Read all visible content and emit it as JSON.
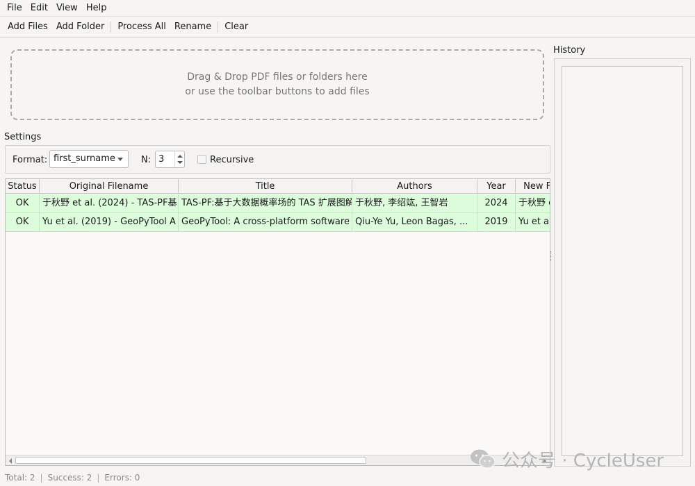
{
  "menu": [
    "File",
    "Edit",
    "View",
    "Help"
  ],
  "toolbar": {
    "add_files": "Add Files",
    "add_folder": "Add Folder",
    "process_all": "Process All",
    "rename": "Rename",
    "clear": "Clear"
  },
  "dropzone": {
    "line1": "Drag & Drop PDF files or folders here",
    "line2": "or use the toolbar buttons to add files"
  },
  "settings": {
    "label": "Settings",
    "format_label": "Format:",
    "format_value": "first_surname",
    "n_label": "N:",
    "n_value": "3",
    "recursive_label": "Recursive",
    "recursive_checked": false
  },
  "table": {
    "columns": [
      "Status",
      "Original Filename",
      "Title",
      "Authors",
      "Year",
      "New Fi"
    ],
    "rows": [
      {
        "status": "OK",
        "original": "于秋野 et al. (2024) - TAS-PF基...",
        "title": "TAS-PF:基于大数据概率场的 TAS 扩展图解",
        "authors": "于秋野, 李绍竑, 王智岩",
        "year": "2024",
        "new": "于秋野 e"
      },
      {
        "status": "OK",
        "original": "Yu et al. (2019) - GeoPyTool A ...",
        "title": "GeoPyTool: A cross-platform software ...",
        "authors": "Qiu-Ye Yu, Leon Bagas, ...",
        "year": "2019",
        "new": "Yu et al."
      }
    ],
    "row_color": "#dcfcdc"
  },
  "history": {
    "label": "History"
  },
  "status": {
    "total": "Total: 2",
    "success": "Success: 2",
    "errors": "Errors: 0"
  },
  "watermark": {
    "text": "公众号 · CycleUser"
  }
}
